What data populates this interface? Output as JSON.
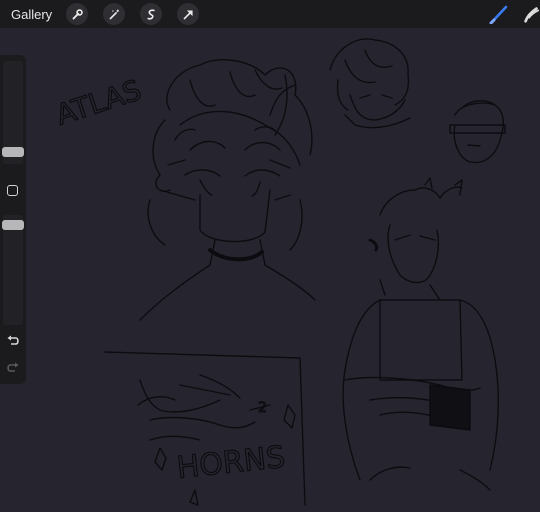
{
  "topbar": {
    "gallery_label": "Gallery",
    "tools": [
      "wrench-icon",
      "magic-wand-icon",
      "selection-icon",
      "transform-arrow-icon"
    ],
    "right_tools": [
      "brush-icon",
      "smudge-icon"
    ],
    "accent": "#3b7bf6"
  },
  "canvas": {
    "background": "#26252f",
    "texts": {
      "atlas": "ATLAS",
      "horns": "HORNS",
      "num": "2"
    }
  }
}
